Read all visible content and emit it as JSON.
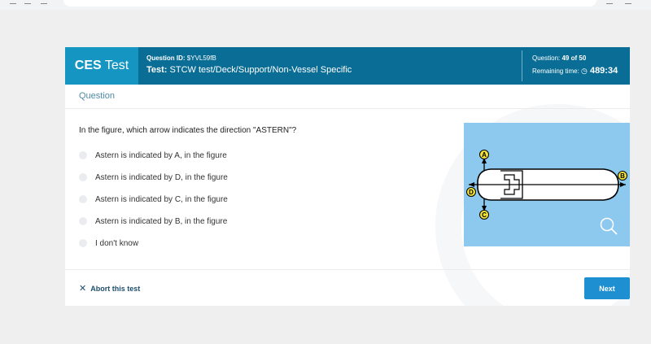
{
  "header": {
    "brand_bold": "CES",
    "brand_rest": " Test",
    "question_id_label": "Question ID:",
    "question_id": " $YVL59fB",
    "test_label": "Test:",
    "test_name": " STCW test/Deck/Support/Non-Vessel Specific",
    "question_label": "Question: ",
    "question_count": "49 of 50",
    "remaining_label": "Remaining time: ",
    "remaining_time": " 489:34"
  },
  "section_label": "Question",
  "question": {
    "text": "In the figure, which arrow indicates the direction \"ASTERN\"?",
    "options": [
      "Astern is indicated by A, in the figure",
      "Astern is indicated by D, in the figure",
      "Astern is indicated by C, in the figure",
      "Astern is indicated by B, in the figure",
      "I don't know"
    ]
  },
  "figure": {
    "labels": {
      "a": "A",
      "b": "B",
      "c": "C",
      "d": "D"
    }
  },
  "footer": {
    "abort_label": "Abort this test",
    "next_label": "Next"
  },
  "colors": {
    "header_bg": "#0a6d95",
    "brand_bg": "#1596c2",
    "figure_bg": "#8dc8ee",
    "next_bg": "#1e8fd0",
    "label_circle": "#f3e23a"
  }
}
